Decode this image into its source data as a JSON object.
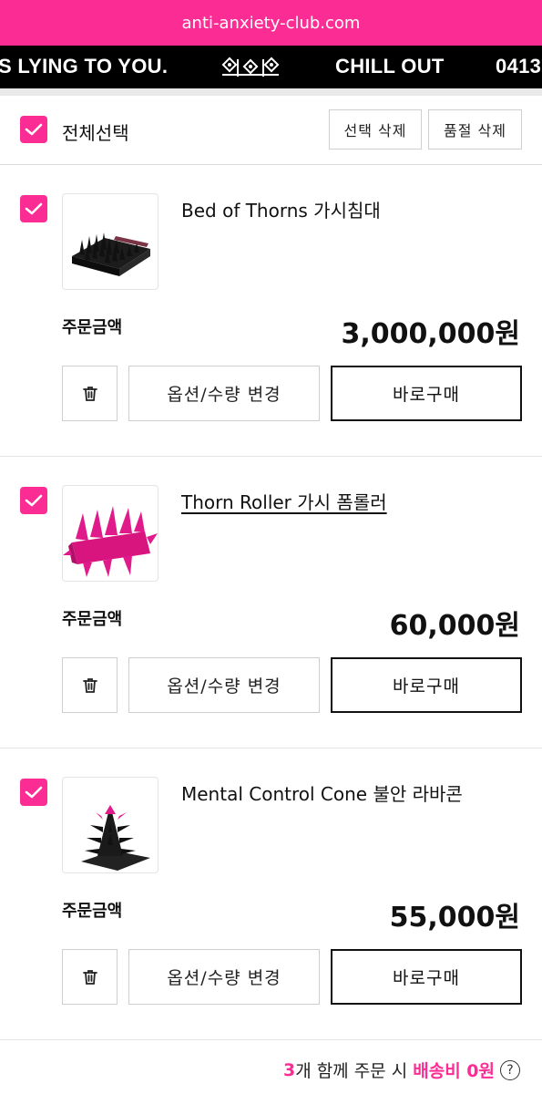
{
  "browser": {
    "url": "anti-anxiety-club.com"
  },
  "marquee": {
    "segments": [
      "S LYING TO YOU.",
      "CHILL OUT",
      "0413"
    ]
  },
  "cart": {
    "select_all_label": "전체선택",
    "delete_selected_label": "선택 삭제",
    "delete_soldout_label": "품절 삭제",
    "items": [
      {
        "name": "Bed of Thorns 가시침대",
        "amount_label": "주문금액",
        "amount": "3,000,000원",
        "option_label": "옵션/수량 변경",
        "buy_label": "바로구매",
        "checked": true
      },
      {
        "name": "Thorn Roller 가시 폼롤러",
        "amount_label": "주문금액",
        "amount": "60,000원",
        "option_label": "옵션/수량 변경",
        "buy_label": "바로구매",
        "checked": true
      },
      {
        "name": "Mental Control Cone 불안 라바콘",
        "amount_label": "주문금액",
        "amount": "55,000원",
        "option_label": "옵션/수량 변경",
        "buy_label": "바로구매",
        "checked": true
      }
    ]
  },
  "footer": {
    "count": "3",
    "text_before": "개 함께 주문 시 ",
    "shipping_highlight": "배송비 0원",
    "help_glyph": "?"
  },
  "colors": {
    "accent": "#fb2c94",
    "marquee_bg": "#000000"
  },
  "icons": [
    "check-icon",
    "trash-icon",
    "help-circle-icon",
    "club-logo-icon"
  ]
}
